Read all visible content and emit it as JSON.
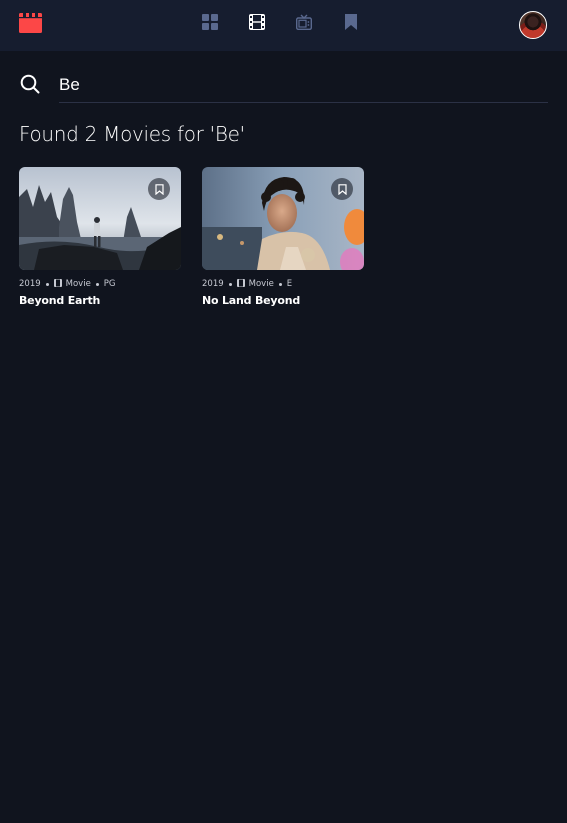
{
  "nav": {
    "logo_icon": "clapperboard-icon",
    "items": [
      {
        "name": "home",
        "icon": "grid-icon",
        "active": false
      },
      {
        "name": "movies",
        "icon": "film-icon",
        "active": true
      },
      {
        "name": "tv-series",
        "icon": "tv-icon",
        "active": false
      },
      {
        "name": "bookmarks",
        "icon": "bookmark-icon",
        "active": false
      }
    ],
    "avatar": "user-avatar"
  },
  "search": {
    "value": "Be",
    "icon": "search-icon"
  },
  "results": {
    "heading": "Found 2 Movies for 'Be'",
    "items": [
      {
        "year": "2019",
        "category": "Movie",
        "rating": "PG",
        "title": "Beyond Earth",
        "bookmarked": false
      },
      {
        "year": "2019",
        "category": "Movie",
        "rating": "E",
        "title": "No Land Beyond",
        "bookmarked": false
      }
    ]
  },
  "colors": {
    "background": "#10141e",
    "nav_background": "#161d2f",
    "accent_red": "#fc4747",
    "nav_icon_inactive": "#5a698f",
    "nav_icon_active": "#ffffff",
    "text": "#ffffff"
  }
}
